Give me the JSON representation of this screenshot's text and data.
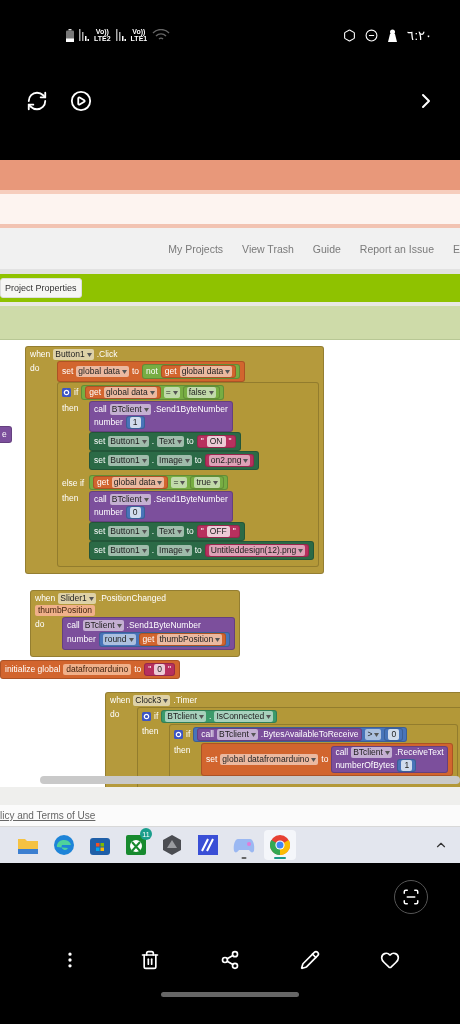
{
  "status_bar": {
    "networks": [
      {
        "voice": "Vo))",
        "type_label": "LTE2"
      },
      {
        "voice": "Vo))",
        "type_label": "LTE1"
      }
    ],
    "time": "٦:٢٠"
  },
  "site": {
    "nav_links": [
      "My Projects",
      "View Trash",
      "Guide",
      "Report an Issue",
      "E"
    ],
    "toolbar_button": "Project Properties",
    "footer_link": "licy and Terms of Use"
  },
  "blocks": [
    {
      "kind": "procedure",
      "rows": [
        {
          "items": [
            {
              "kind": "kw",
              "text": "e"
            }
          ]
        }
      ]
    },
    {
      "kind": "event",
      "rows": [
        {
          "items": [
            {
              "kind": "kw",
              "text": "when"
            },
            {
              "kind": "dd",
              "text": "Button1"
            },
            {
              "kind": "kw",
              "text": ".Click"
            }
          ]
        },
        {
          "label": "do",
          "body": [
            {
              "kind": "variable",
              "rows": [
                {
                  "items": [
                    {
                      "kind": "kw",
                      "text": "set"
                    },
                    {
                      "kind": "dd",
                      "text": "global data"
                    },
                    {
                      "kind": "kw",
                      "text": "to"
                    },
                    {
                      "kind": "block",
                      "block": {
                        "kind": "logic",
                        "rows": [
                          {
                            "items": [
                              {
                                "kind": "kw",
                                "text": "not"
                              },
                              {
                                "kind": "block",
                                "block": {
                                  "kind": "variable",
                                  "rows": [
                                    {
                                      "items": [
                                        {
                                          "kind": "kw",
                                          "text": "get"
                                        },
                                        {
                                          "kind": "dd",
                                          "text": "global data"
                                        }
                                      ]
                                    }
                                  ]
                                }
                              }
                            ]
                          }
                        ]
                      }
                    }
                  ]
                }
              ]
            },
            {
              "kind": "control",
              "rows": [
                {
                  "items": [
                    {
                      "kind": "gear"
                    },
                    {
                      "kind": "kw",
                      "text": "if"
                    },
                    {
                      "kind": "block",
                      "block": {
                        "kind": "logic",
                        "rows": [
                          {
                            "items": [
                              {
                                "kind": "block",
                                "block": {
                                  "kind": "variable",
                                  "rows": [
                                    {
                                      "items": [
                                        {
                                          "kind": "kw",
                                          "text": "get"
                                        },
                                        {
                                          "kind": "dd",
                                          "text": "global data"
                                        }
                                      ]
                                    }
                                  ]
                                }
                              },
                              {
                                "kind": "dd",
                                "text": "="
                              },
                              {
                                "kind": "block",
                                "block": {
                                  "kind": "logic",
                                  "rows": [
                                    {
                                      "items": [
                                        {
                                          "kind": "dd",
                                          "text": "false"
                                        }
                                      ]
                                    }
                                  ]
                                }
                              }
                            ]
                          }
                        ]
                      }
                    }
                  ]
                },
                {
                  "label": "then",
                  "body": [
                    {
                      "kind": "procedure",
                      "rows": [
                        {
                          "items": [
                            {
                              "kind": "kw",
                              "text": "call"
                            },
                            {
                              "kind": "dd",
                              "text": "BTclient"
                            },
                            {
                              "kind": "kw",
                              "text": ".Send1ByteNumber"
                            }
                          ]
                        },
                        {
                          "items": [
                            {
                              "kind": "kw",
                              "text": "number"
                            },
                            {
                              "kind": "block",
                              "block": {
                                "kind": "math",
                                "rows": [
                                  {
                                    "items": [
                                      {
                                        "kind": "val",
                                        "text": "1"
                                      }
                                    ]
                                  }
                                ]
                              }
                            }
                          ]
                        }
                      ]
                    },
                    {
                      "kind": "setter",
                      "rows": [
                        {
                          "items": [
                            {
                              "kind": "kw",
                              "text": "set"
                            },
                            {
                              "kind": "dd",
                              "text": "Button1"
                            },
                            {
                              "kind": "kw",
                              "text": "."
                            },
                            {
                              "kind": "dd",
                              "text": "Text"
                            },
                            {
                              "kind": "kw",
                              "text": "to"
                            },
                            {
                              "kind": "block",
                              "block": {
                                "kind": "text",
                                "rows": [
                                  {
                                    "items": [
                                      {
                                        "kind": "kw",
                                        "text": "\""
                                      },
                                      {
                                        "kind": "val",
                                        "text": "ON"
                                      },
                                      {
                                        "kind": "kw",
                                        "text": "\""
                                      }
                                    ]
                                  }
                                ]
                              }
                            }
                          ]
                        }
                      ]
                    },
                    {
                      "kind": "setter",
                      "rows": [
                        {
                          "items": [
                            {
                              "kind": "kw",
                              "text": "set"
                            },
                            {
                              "kind": "dd",
                              "text": "Button1"
                            },
                            {
                              "kind": "kw",
                              "text": "."
                            },
                            {
                              "kind": "dd",
                              "text": "Image"
                            },
                            {
                              "kind": "kw",
                              "text": "to"
                            },
                            {
                              "kind": "block",
                              "block": {
                                "kind": "text",
                                "rows": [
                                  {
                                    "items": [
                                      {
                                        "kind": "dd",
                                        "text": "on2.png"
                                      }
                                    ]
                                  }
                                ]
                              }
                            }
                          ]
                        }
                      ]
                    }
                  ]
                },
                {
                  "label": "else if",
                  "items": [
                    {
                      "kind": "block",
                      "block": {
                        "kind": "logic",
                        "rows": [
                          {
                            "items": [
                              {
                                "kind": "block",
                                "block": {
                                  "kind": "variable",
                                  "rows": [
                                    {
                                      "items": [
                                        {
                                          "kind": "kw",
                                          "text": "get"
                                        },
                                        {
                                          "kind": "dd",
                                          "text": "global data"
                                        }
                                      ]
                                    }
                                  ]
                                }
                              },
                              {
                                "kind": "dd",
                                "text": "="
                              },
                              {
                                "kind": "block",
                                "block": {
                                  "kind": "logic",
                                  "rows": [
                                    {
                                      "items": [
                                        {
                                          "kind": "dd",
                                          "text": "true"
                                        }
                                      ]
                                    }
                                  ]
                                }
                              }
                            ]
                          }
                        ]
                      }
                    }
                  ]
                },
                {
                  "label": "then",
                  "body": [
                    {
                      "kind": "procedure",
                      "rows": [
                        {
                          "items": [
                            {
                              "kind": "kw",
                              "text": "call"
                            },
                            {
                              "kind": "dd",
                              "text": "BTclient"
                            },
                            {
                              "kind": "kw",
                              "text": ".Send1ByteNumber"
                            }
                          ]
                        },
                        {
                          "items": [
                            {
                              "kind": "kw",
                              "text": "number"
                            },
                            {
                              "kind": "block",
                              "block": {
                                "kind": "math",
                                "rows": [
                                  {
                                    "items": [
                                      {
                                        "kind": "val",
                                        "text": "0"
                                      }
                                    ]
                                  }
                                ]
                              }
                            }
                          ]
                        }
                      ]
                    },
                    {
                      "kind": "setter",
                      "rows": [
                        {
                          "items": [
                            {
                              "kind": "kw",
                              "text": "set"
                            },
                            {
                              "kind": "dd",
                              "text": "Button1"
                            },
                            {
                              "kind": "kw",
                              "text": "."
                            },
                            {
                              "kind": "dd",
                              "text": "Text"
                            },
                            {
                              "kind": "kw",
                              "text": "to"
                            },
                            {
                              "kind": "block",
                              "block": {
                                "kind": "text",
                                "rows": [
                                  {
                                    "items": [
                                      {
                                        "kind": "kw",
                                        "text": "\""
                                      },
                                      {
                                        "kind": "val",
                                        "text": "OFF"
                                      },
                                      {
                                        "kind": "kw",
                                        "text": "\""
                                      }
                                    ]
                                  }
                                ]
                              }
                            }
                          ]
                        }
                      ]
                    },
                    {
                      "kind": "setter",
                      "rows": [
                        {
                          "items": [
                            {
                              "kind": "kw",
                              "text": "set"
                            },
                            {
                              "kind": "dd",
                              "text": "Button1"
                            },
                            {
                              "kind": "kw",
                              "text": "."
                            },
                            {
                              "kind": "dd",
                              "text": "Image"
                            },
                            {
                              "kind": "kw",
                              "text": "to"
                            },
                            {
                              "kind": "block",
                              "block": {
                                "kind": "text",
                                "rows": [
                                  {
                                    "items": [
                                      {
                                        "kind": "dd",
                                        "text": "Untitleddesign(12).png"
                                      }
                                    ]
                                  }
                                ]
                              }
                            }
                          ]
                        }
                      ]
                    }
                  ]
                }
              ]
            }
          ]
        }
      ]
    },
    {
      "kind": "event",
      "rows": [
        {
          "items": [
            {
              "kind": "kw",
              "text": "when"
            },
            {
              "kind": "dd",
              "text": "Slider1"
            },
            {
              "kind": "kw",
              "text": ".PositionChanged"
            }
          ]
        },
        {
          "items": [
            {
              "kind": "param",
              "text": "thumbPosition"
            }
          ]
        },
        {
          "label": "do",
          "body": [
            {
              "kind": "procedure",
              "rows": [
                {
                  "items": [
                    {
                      "kind": "kw",
                      "text": "call"
                    },
                    {
                      "kind": "dd",
                      "text": "BTclient"
                    },
                    {
                      "kind": "kw",
                      "text": ".Send1ByteNumber"
                    }
                  ]
                },
                {
                  "items": [
                    {
                      "kind": "kw",
                      "text": "number"
                    },
                    {
                      "kind": "block",
                      "block": {
                        "kind": "math",
                        "rows": [
                          {
                            "items": [
                              {
                                "kind": "dd",
                                "text": "round"
                              },
                              {
                                "kind": "block",
                                "block": {
                                  "kind": "variable",
                                  "rows": [
                                    {
                                      "items": [
                                        {
                                          "kind": "kw",
                                          "text": "get"
                                        },
                                        {
                                          "kind": "dd",
                                          "text": "thumbPosition"
                                        }
                                      ]
                                    }
                                  ]
                                }
                              }
                            ]
                          }
                        ]
                      }
                    }
                  ]
                }
              ]
            }
          ]
        }
      ]
    },
    {
      "kind": "variable",
      "rows": [
        {
          "items": [
            {
              "kind": "kw",
              "text": "initialize global"
            },
            {
              "kind": "param",
              "text": "datafromarduino"
            },
            {
              "kind": "kw",
              "text": "to"
            },
            {
              "kind": "block",
              "block": {
                "kind": "text",
                "rows": [
                  {
                    "items": [
                      {
                        "kind": "kw",
                        "text": "\""
                      },
                      {
                        "kind": "val",
                        "text": "0"
                      },
                      {
                        "kind": "kw",
                        "text": "\""
                      }
                    ]
                  }
                ]
              }
            }
          ]
        }
      ]
    },
    {
      "kind": "event",
      "rows": [
        {
          "items": [
            {
              "kind": "kw",
              "text": "when"
            },
            {
              "kind": "dd",
              "text": "Clock3"
            },
            {
              "kind": "kw",
              "text": ".Timer"
            }
          ]
        },
        {
          "label": "do",
          "body": [
            {
              "kind": "control",
              "rows": [
                {
                  "items": [
                    {
                      "kind": "gear"
                    },
                    {
                      "kind": "kw",
                      "text": "if"
                    },
                    {
                      "kind": "block",
                      "block": {
                        "kind": "component",
                        "rows": [
                          {
                            "items": [
                              {
                                "kind": "dd",
                                "text": "BTclient"
                              },
                              {
                                "kind": "kw",
                                "text": "."
                              },
                              {
                                "kind": "dd",
                                "text": "IsConnected"
                              }
                            ]
                          }
                        ]
                      }
                    }
                  ]
                },
                {
                  "label": "then",
                  "body": [
                    {
                      "kind": "control",
                      "rows": [
                        {
                          "items": [
                            {
                              "kind": "gear"
                            },
                            {
                              "kind": "kw",
                              "text": "if"
                            },
                            {
                              "kind": "block",
                              "block": {
                                "kind": "math",
                                "rows": [
                                  {
                                    "items": [
                                      {
                                        "kind": "block",
                                        "block": {
                                          "kind": "procedure",
                                          "rows": [
                                            {
                                              "items": [
                                                {
                                                  "kind": "kw",
                                                  "text": "call"
                                                },
                                                {
                                                  "kind": "dd",
                                                  "text": "BTclient"
                                                },
                                                {
                                                  "kind": "kw",
                                                  "text": ".BytesAvailableToReceive"
                                                }
                                              ]
                                            }
                                          ]
                                        }
                                      },
                                      {
                                        "kind": "dd",
                                        "text": ">"
                                      },
                                      {
                                        "kind": "block",
                                        "block": {
                                          "kind": "math",
                                          "rows": [
                                            {
                                              "items": [
                                                {
                                                  "kind": "val",
                                                  "text": "0"
                                                }
                                              ]
                                            }
                                          ]
                                        }
                                      }
                                    ]
                                  }
                                ]
                              }
                            }
                          ]
                        },
                        {
                          "label": "then",
                          "body": [
                            {
                              "kind": "variable",
                              "rows": [
                                {
                                  "items": [
                                    {
                                      "kind": "kw",
                                      "text": "set"
                                    },
                                    {
                                      "kind": "dd",
                                      "text": "global datafromarduino"
                                    },
                                    {
                                      "kind": "kw",
                                      "text": "to"
                                    },
                                    {
                                      "kind": "block",
                                      "block": {
                                        "kind": "procedure",
                                        "rows": [
                                          {
                                            "items": [
                                              {
                                                "kind": "kw",
                                                "text": "call"
                                              },
                                              {
                                                "kind": "dd",
                                                "text": "BTclient"
                                              },
                                              {
                                                "kind": "kw",
                                                "text": ".ReceiveText"
                                              }
                                            ]
                                          },
                                          {
                                            "items": [
                                              {
                                                "kind": "kw",
                                                "text": "numberOfBytes"
                                              },
                                              {
                                                "kind": "block",
                                                "block": {
                                                  "kind": "math",
                                                  "rows": [
                                                    {
                                                      "items": [
                                                        {
                                                          "kind": "val",
                                                          "text": "1"
                                                        }
                                                      ]
                                                    }
                                                  ]
                                                }
                                              }
                                            ]
                                          }
                                        ]
                                      }
                                    }
                                  ]
                                }
                              ]
                            }
                          ]
                        }
                      ]
                    }
                  ]
                }
              ]
            }
          ]
        }
      ]
    }
  ],
  "taskbar": {
    "apps": [
      {
        "kind": "folder",
        "selected": false,
        "running": false
      },
      {
        "kind": "edge",
        "selected": false,
        "running": false
      },
      {
        "kind": "store",
        "selected": false,
        "running": false
      },
      {
        "kind": "xbox",
        "selected": false,
        "running": false,
        "badge": "11"
      },
      {
        "kind": "hex",
        "selected": false,
        "running": false
      },
      {
        "kind": "mapp",
        "selected": false,
        "running": false
      },
      {
        "kind": "gamepad",
        "selected": false,
        "running": true
      },
      {
        "kind": "chrome",
        "selected": true,
        "running": true
      }
    ]
  }
}
